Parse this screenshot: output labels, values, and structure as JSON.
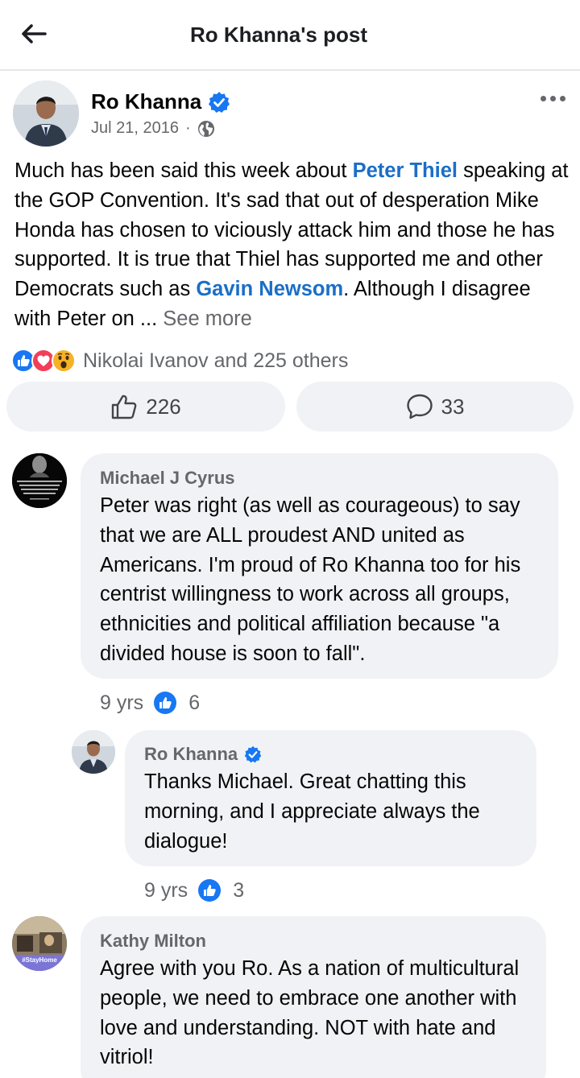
{
  "header": {
    "title": "Ro Khanna's post",
    "back_icon": "arrow-left-icon"
  },
  "post": {
    "author": "Ro Khanna",
    "date": "Jul 21, 2016",
    "separator": "·",
    "privacy_icon": "globe-icon",
    "text_1": "Much has been said this week about ",
    "link_1": "Peter Thiel",
    "text_2": " speaking at the GOP Convention.  It's sad that out of desperation Mike Honda has chosen to viciously attack him and those he has supported. It is true that Thiel has supported me and other Democrats such as ",
    "link_2": "Gavin Newsom",
    "text_3": ". Although I disagree with Peter on ... ",
    "see_more": "See more",
    "reactions_text": "Nikolai Ivanov and 225 others",
    "like_count": "226",
    "comment_count": "33"
  },
  "comments": [
    {
      "name": "Michael J Cyrus",
      "text": "Peter was right (as well as courageous) to say that we are ALL proudest AND united as Americans. I'm proud of Ro Khanna too for his centrist willingness to work across all groups, ethnicities and political affiliation because \"a divided house is soon to fall\".",
      "age": "9 yrs",
      "likes": "6"
    },
    {
      "name": "Ro Khanna",
      "text": "Thanks Michael. Great chatting this morning, and I appreciate  always the dialogue!",
      "age": "9 yrs",
      "likes": "3"
    },
    {
      "name": "Kathy Milton",
      "text": "Agree with you Ro. As a nation of multicultural people, we need to embrace one another with love and understanding. NOT with hate and vitriol!",
      "avatar_tag": "#StayHome"
    }
  ],
  "colors": {
    "link": "#1b6ec7",
    "verified": "#1877f2",
    "bubble": "#f0f2f5",
    "secondary_text": "#65676b"
  }
}
